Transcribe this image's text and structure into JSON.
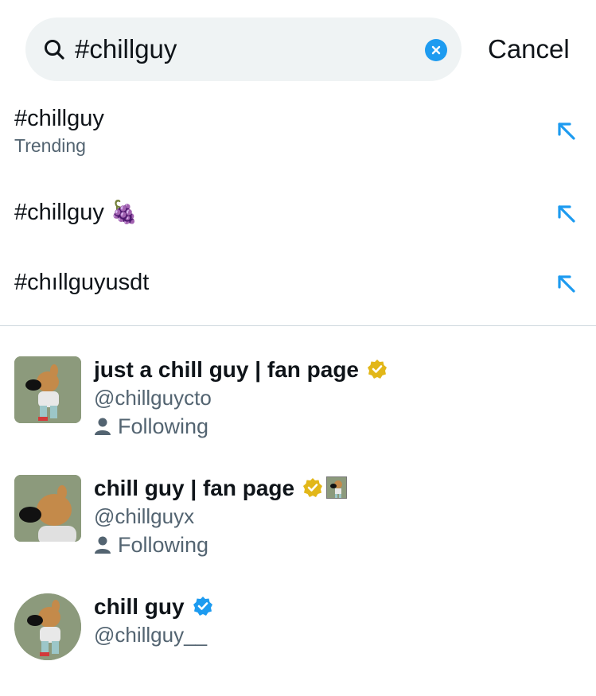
{
  "search": {
    "query": "#chillguy",
    "cancel_label": "Cancel"
  },
  "suggestions": [
    {
      "title": "#chillguy",
      "subtitle": "Trending",
      "emoji": ""
    },
    {
      "title": "#chillguy",
      "subtitle": "",
      "emoji": "🍇"
    },
    {
      "title": "#chıllguyusdt",
      "subtitle": "",
      "emoji": ""
    }
  ],
  "users": [
    {
      "name": "just a chill guy | fan page",
      "handle": "@chillguycto",
      "relationship": "Following",
      "badge": "gold-verified-icon"
    },
    {
      "name": "chill guy | fan page",
      "handle": "@chillguyx",
      "relationship": "Following",
      "badge": "gold-verified-icon"
    },
    {
      "name": "chill guy",
      "handle": "@chillguy__",
      "relationship": "",
      "badge": "blue-verified-icon"
    }
  ],
  "colors": {
    "accent_blue": "#1d9bf0",
    "gold_badge": "#e2b719",
    "secondary_text": "#536471",
    "search_bg": "#eff3f4"
  }
}
